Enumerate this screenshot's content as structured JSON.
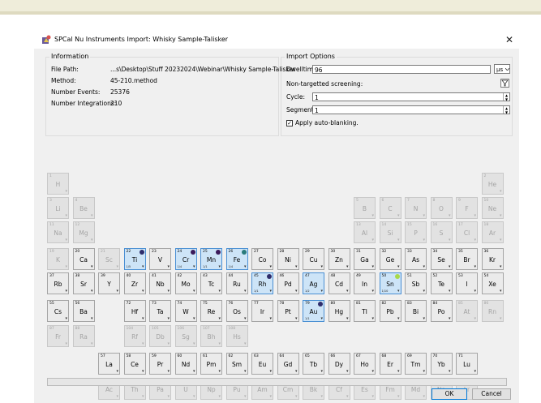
{
  "window": {
    "title": "SPCal Nu Instruments Import: Whisky Sample-Talisker",
    "close_glyph": "✕"
  },
  "information": {
    "title": "Information",
    "rows": [
      {
        "label": "File Path:",
        "value": "...s\\Desktop\\Stuff 20232024\\Webinar\\Whisky Sample-Talisker"
      },
      {
        "label": "Method:",
        "value": "45-210.method"
      },
      {
        "label": "Number Events:",
        "value": "25376"
      },
      {
        "label": "Number Integrations:",
        "value": "210"
      }
    ]
  },
  "import_options": {
    "title": "Import Options",
    "dwelltime_label": "Dwelltime:",
    "dwelltime_value": "96",
    "dwelltime_unit": "µs",
    "nontargeted_label": "Non-targetted screening:",
    "cycle_label": "Cycle:",
    "cycle_value": "1",
    "segment_label": "Segment:",
    "segment_value": "1",
    "autoblank_label": "Apply auto-blanking.",
    "autoblank_checked": true
  },
  "elements": [
    {
      "z": "1",
      "s": "H",
      "r": 1,
      "c": 1,
      "st": "d"
    },
    {
      "z": "2",
      "s": "He",
      "r": 1,
      "c": 18,
      "st": "d"
    },
    {
      "z": "3",
      "s": "Li",
      "r": 2,
      "c": 1,
      "st": "d"
    },
    {
      "z": "4",
      "s": "Be",
      "r": 2,
      "c": 2,
      "st": "d"
    },
    {
      "z": "5",
      "s": "B",
      "r": 2,
      "c": 13,
      "st": "d"
    },
    {
      "z": "6",
      "s": "C",
      "r": 2,
      "c": 14,
      "st": "d"
    },
    {
      "z": "7",
      "s": "N",
      "r": 2,
      "c": 15,
      "st": "d"
    },
    {
      "z": "8",
      "s": "O",
      "r": 2,
      "c": 16,
      "st": "d"
    },
    {
      "z": "9",
      "s": "F",
      "r": 2,
      "c": 17,
      "st": "d"
    },
    {
      "z": "10",
      "s": "Ne",
      "r": 2,
      "c": 18,
      "st": "d"
    },
    {
      "z": "11",
      "s": "Na",
      "r": 3,
      "c": 1,
      "st": "d"
    },
    {
      "z": "12",
      "s": "Mg",
      "r": 3,
      "c": 2,
      "st": "d"
    },
    {
      "z": "13",
      "s": "Al",
      "r": 3,
      "c": 13,
      "st": "d"
    },
    {
      "z": "14",
      "s": "Si",
      "r": 3,
      "c": 14,
      "st": "d"
    },
    {
      "z": "15",
      "s": "P",
      "r": 3,
      "c": 15,
      "st": "d"
    },
    {
      "z": "16",
      "s": "S",
      "r": 3,
      "c": 16,
      "st": "d"
    },
    {
      "z": "17",
      "s": "Cl",
      "r": 3,
      "c": 17,
      "st": "d"
    },
    {
      "z": "18",
      "s": "Ar",
      "r": 3,
      "c": 18,
      "st": "d"
    },
    {
      "z": "19",
      "s": "K",
      "r": 4,
      "c": 1,
      "st": "d"
    },
    {
      "z": "20",
      "s": "Ca",
      "r": 4,
      "c": 2,
      "st": "e"
    },
    {
      "z": "21",
      "s": "Sc",
      "r": 4,
      "c": 3,
      "st": "d"
    },
    {
      "z": "22",
      "s": "Ti",
      "r": 4,
      "c": 4,
      "st": "s",
      "cnt": "1/5",
      "dot": "#2f2d6b"
    },
    {
      "z": "23",
      "s": "V",
      "r": 4,
      "c": 5,
      "st": "e"
    },
    {
      "z": "24",
      "s": "Cr",
      "r": 4,
      "c": 6,
      "st": "s",
      "cnt": "1/4",
      "dot": "#3b1a5a"
    },
    {
      "z": "25",
      "s": "Mn",
      "r": 4,
      "c": 7,
      "st": "s",
      "cnt": "1/1",
      "dot": "#3b1a5a"
    },
    {
      "z": "26",
      "s": "Fe",
      "r": 4,
      "c": 8,
      "st": "s",
      "cnt": "1/4",
      "dot": "#2a7b7b"
    },
    {
      "z": "27",
      "s": "Co",
      "r": 4,
      "c": 9,
      "st": "e"
    },
    {
      "z": "28",
      "s": "Ni",
      "r": 4,
      "c": 10,
      "st": "e"
    },
    {
      "z": "29",
      "s": "Cu",
      "r": 4,
      "c": 11,
      "st": "e"
    },
    {
      "z": "30",
      "s": "Zn",
      "r": 4,
      "c": 12,
      "st": "e"
    },
    {
      "z": "31",
      "s": "Ga",
      "r": 4,
      "c": 13,
      "st": "e"
    },
    {
      "z": "32",
      "s": "Ge",
      "r": 4,
      "c": 14,
      "st": "e"
    },
    {
      "z": "33",
      "s": "As",
      "r": 4,
      "c": 15,
      "st": "e"
    },
    {
      "z": "34",
      "s": "Se",
      "r": 4,
      "c": 16,
      "st": "e"
    },
    {
      "z": "35",
      "s": "Br",
      "r": 4,
      "c": 17,
      "st": "e"
    },
    {
      "z": "36",
      "s": "Kr",
      "r": 4,
      "c": 18,
      "st": "e"
    },
    {
      "z": "37",
      "s": "Rb",
      "r": 5,
      "c": 1,
      "st": "e"
    },
    {
      "z": "38",
      "s": "Sr",
      "r": 5,
      "c": 2,
      "st": "e"
    },
    {
      "z": "39",
      "s": "Y",
      "r": 5,
      "c": 3,
      "st": "e"
    },
    {
      "z": "40",
      "s": "Zr",
      "r": 5,
      "c": 4,
      "st": "e"
    },
    {
      "z": "41",
      "s": "Nb",
      "r": 5,
      "c": 5,
      "st": "e"
    },
    {
      "z": "42",
      "s": "Mo",
      "r": 5,
      "c": 6,
      "st": "e"
    },
    {
      "z": "43",
      "s": "Tc",
      "r": 5,
      "c": 7,
      "st": "e"
    },
    {
      "z": "44",
      "s": "Ru",
      "r": 5,
      "c": 8,
      "st": "e"
    },
    {
      "z": "45",
      "s": "Rh",
      "r": 5,
      "c": 9,
      "st": "s",
      "cnt": "1/1",
      "dot": "#2f2d6b"
    },
    {
      "z": "46",
      "s": "Pd",
      "r": 5,
      "c": 10,
      "st": "e"
    },
    {
      "z": "47",
      "s": "Ag",
      "r": 5,
      "c": 11,
      "st": "s",
      "cnt": "1/2",
      "dot": ""
    },
    {
      "z": "48",
      "s": "Cd",
      "r": 5,
      "c": 12,
      "st": "e"
    },
    {
      "z": "49",
      "s": "In",
      "r": 5,
      "c": 13,
      "st": "e"
    },
    {
      "z": "50",
      "s": "Sn",
      "r": 5,
      "c": 14,
      "st": "s",
      "cnt": "1/10",
      "dot": "#a8d94a"
    },
    {
      "z": "51",
      "s": "Sb",
      "r": 5,
      "c": 15,
      "st": "e"
    },
    {
      "z": "52",
      "s": "Te",
      "r": 5,
      "c": 16,
      "st": "e"
    },
    {
      "z": "53",
      "s": "I",
      "r": 5,
      "c": 17,
      "st": "e"
    },
    {
      "z": "54",
      "s": "Xe",
      "r": 5,
      "c": 18,
      "st": "e"
    },
    {
      "z": "55",
      "s": "Cs",
      "r": 6,
      "c": 1,
      "st": "e"
    },
    {
      "z": "56",
      "s": "Ba",
      "r": 6,
      "c": 2,
      "st": "e"
    },
    {
      "z": "72",
      "s": "Hf",
      "r": 6,
      "c": 4,
      "st": "e"
    },
    {
      "z": "73",
      "s": "Ta",
      "r": 6,
      "c": 5,
      "st": "e"
    },
    {
      "z": "74",
      "s": "W",
      "r": 6,
      "c": 6,
      "st": "e"
    },
    {
      "z": "75",
      "s": "Re",
      "r": 6,
      "c": 7,
      "st": "e"
    },
    {
      "z": "76",
      "s": "Os",
      "r": 6,
      "c": 8,
      "st": "e"
    },
    {
      "z": "77",
      "s": "Ir",
      "r": 6,
      "c": 9,
      "st": "e"
    },
    {
      "z": "78",
      "s": "Pt",
      "r": 6,
      "c": 10,
      "st": "e"
    },
    {
      "z": "79",
      "s": "Au",
      "r": 6,
      "c": 11,
      "st": "s",
      "cnt": "1/1",
      "dot": "#2f2d6b"
    },
    {
      "z": "80",
      "s": "Hg",
      "r": 6,
      "c": 12,
      "st": "e"
    },
    {
      "z": "81",
      "s": "Tl",
      "r": 6,
      "c": 13,
      "st": "e"
    },
    {
      "z": "82",
      "s": "Pb",
      "r": 6,
      "c": 14,
      "st": "e"
    },
    {
      "z": "83",
      "s": "Bi",
      "r": 6,
      "c": 15,
      "st": "e"
    },
    {
      "z": "84",
      "s": "Po",
      "r": 6,
      "c": 16,
      "st": "e"
    },
    {
      "z": "85",
      "s": "At",
      "r": 6,
      "c": 17,
      "st": "d"
    },
    {
      "z": "86",
      "s": "Rn",
      "r": 6,
      "c": 18,
      "st": "d"
    },
    {
      "z": "87",
      "s": "Fr",
      "r": 7,
      "c": 1,
      "st": "d"
    },
    {
      "z": "88",
      "s": "Ra",
      "r": 7,
      "c": 2,
      "st": "d"
    },
    {
      "z": "104",
      "s": "Rf",
      "r": 7,
      "c": 4,
      "st": "d"
    },
    {
      "z": "105",
      "s": "Db",
      "r": 7,
      "c": 5,
      "st": "d"
    },
    {
      "z": "106",
      "s": "Sg",
      "r": 7,
      "c": 6,
      "st": "d"
    },
    {
      "z": "107",
      "s": "Bh",
      "r": 7,
      "c": 7,
      "st": "d"
    },
    {
      "z": "108",
      "s": "Hs",
      "r": 7,
      "c": 8,
      "st": "d"
    },
    {
      "z": "57",
      "s": "La",
      "r": 8,
      "c": 3,
      "st": "e"
    },
    {
      "z": "58",
      "s": "Ce",
      "r": 8,
      "c": 4,
      "st": "e"
    },
    {
      "z": "59",
      "s": "Pr",
      "r": 8,
      "c": 5,
      "st": "e"
    },
    {
      "z": "60",
      "s": "Nd",
      "r": 8,
      "c": 6,
      "st": "e"
    },
    {
      "z": "61",
      "s": "Pm",
      "r": 8,
      "c": 7,
      "st": "e"
    },
    {
      "z": "62",
      "s": "Sm",
      "r": 8,
      "c": 8,
      "st": "e"
    },
    {
      "z": "63",
      "s": "Eu",
      "r": 8,
      "c": 9,
      "st": "e"
    },
    {
      "z": "64",
      "s": "Gd",
      "r": 8,
      "c": 10,
      "st": "e"
    },
    {
      "z": "65",
      "s": "Tb",
      "r": 8,
      "c": 11,
      "st": "e"
    },
    {
      "z": "66",
      "s": "Dy",
      "r": 8,
      "c": 12,
      "st": "e"
    },
    {
      "z": "67",
      "s": "Ho",
      "r": 8,
      "c": 13,
      "st": "e"
    },
    {
      "z": "68",
      "s": "Er",
      "r": 8,
      "c": 14,
      "st": "e"
    },
    {
      "z": "69",
      "s": "Tm",
      "r": 8,
      "c": 15,
      "st": "e"
    },
    {
      "z": "70",
      "s": "Yb",
      "r": 8,
      "c": 16,
      "st": "e"
    },
    {
      "z": "71",
      "s": "Lu",
      "r": 8,
      "c": 17,
      "st": "e"
    },
    {
      "z": "89",
      "s": "Ac",
      "r": 9,
      "c": 3,
      "st": "d"
    },
    {
      "z": "90",
      "s": "Th",
      "r": 9,
      "c": 4,
      "st": "d"
    },
    {
      "z": "91",
      "s": "Pa",
      "r": 9,
      "c": 5,
      "st": "d"
    },
    {
      "z": "92",
      "s": "U",
      "r": 9,
      "c": 6,
      "st": "d"
    },
    {
      "z": "93",
      "s": "Np",
      "r": 9,
      "c": 7,
      "st": "d"
    },
    {
      "z": "94",
      "s": "Pu",
      "r": 9,
      "c": 8,
      "st": "d"
    },
    {
      "z": "95",
      "s": "Am",
      "r": 9,
      "c": 9,
      "st": "d"
    },
    {
      "z": "96",
      "s": "Cm",
      "r": 9,
      "c": 10,
      "st": "d"
    },
    {
      "z": "97",
      "s": "Bk",
      "r": 9,
      "c": 11,
      "st": "d"
    },
    {
      "z": "98",
      "s": "Cf",
      "r": 9,
      "c": 12,
      "st": "d"
    },
    {
      "z": "99",
      "s": "Es",
      "r": 9,
      "c": 13,
      "st": "d"
    },
    {
      "z": "100",
      "s": "Fm",
      "r": 9,
      "c": 14,
      "st": "d"
    },
    {
      "z": "101",
      "s": "Md",
      "r": 9,
      "c": 15,
      "st": "d"
    },
    {
      "z": "102",
      "s": "No",
      "r": 9,
      "c": 16,
      "st": "d"
    },
    {
      "z": "103",
      "s": "Lr",
      "r": 9,
      "c": 17,
      "st": "d"
    }
  ],
  "buttons": {
    "ok": "OK",
    "cancel": "Cancel"
  },
  "colors": {
    "selected_fill": "#cde4f7",
    "selected_border": "#4a8fd3",
    "accent": "#0078d7"
  }
}
